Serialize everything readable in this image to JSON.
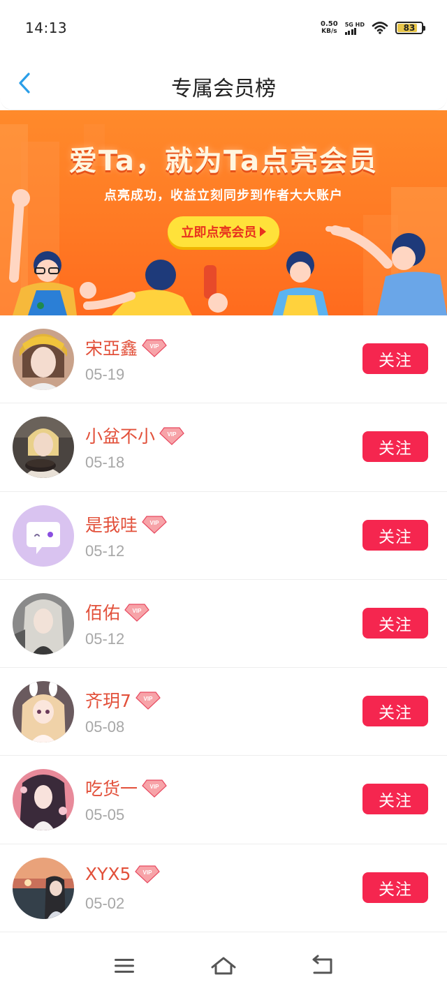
{
  "status_bar": {
    "time": "14:13",
    "net_speed_value": "0.50",
    "net_speed_unit": "KB/s",
    "signal_label": "5G HD",
    "battery_level": "83",
    "battery_fraction": 0.83,
    "battery_color": "#e8c64a"
  },
  "header": {
    "title": "专属会员榜",
    "back_icon": "chevron-left-icon"
  },
  "banner": {
    "headline": "爱Ta，就为Ta点亮会员",
    "subtitle": "点亮成功，收益立刻同步到作者大大账户",
    "cta_label": "立即点亮会员"
  },
  "members": [
    {
      "name": "宋亞鑫",
      "date": "05-19",
      "follow_label": "关注"
    },
    {
      "name": "小盆不小",
      "date": "05-18",
      "follow_label": "关注"
    },
    {
      "name": "是我哇",
      "date": "05-12",
      "follow_label": "关注"
    },
    {
      "name": "佰佑",
      "date": "05-12",
      "follow_label": "关注"
    },
    {
      "name": "齐玥7",
      "date": "05-08",
      "follow_label": "关注"
    },
    {
      "name": "吃货一",
      "date": "05-05",
      "follow_label": "关注"
    },
    {
      "name": "XYX5",
      "date": "05-02",
      "follow_label": "关注"
    }
  ],
  "vip_badge_text": "VIP",
  "nav": {
    "menu_icon": "menu-icon",
    "home_icon": "home-icon",
    "back_icon": "back-icon"
  },
  "colors": {
    "accent_pink": "#f5264f",
    "name_red": "#e2503a",
    "banner_orange": "#ff7a24",
    "cta_yellow": "#ffe23a",
    "back_blue": "#2a9ee8"
  }
}
